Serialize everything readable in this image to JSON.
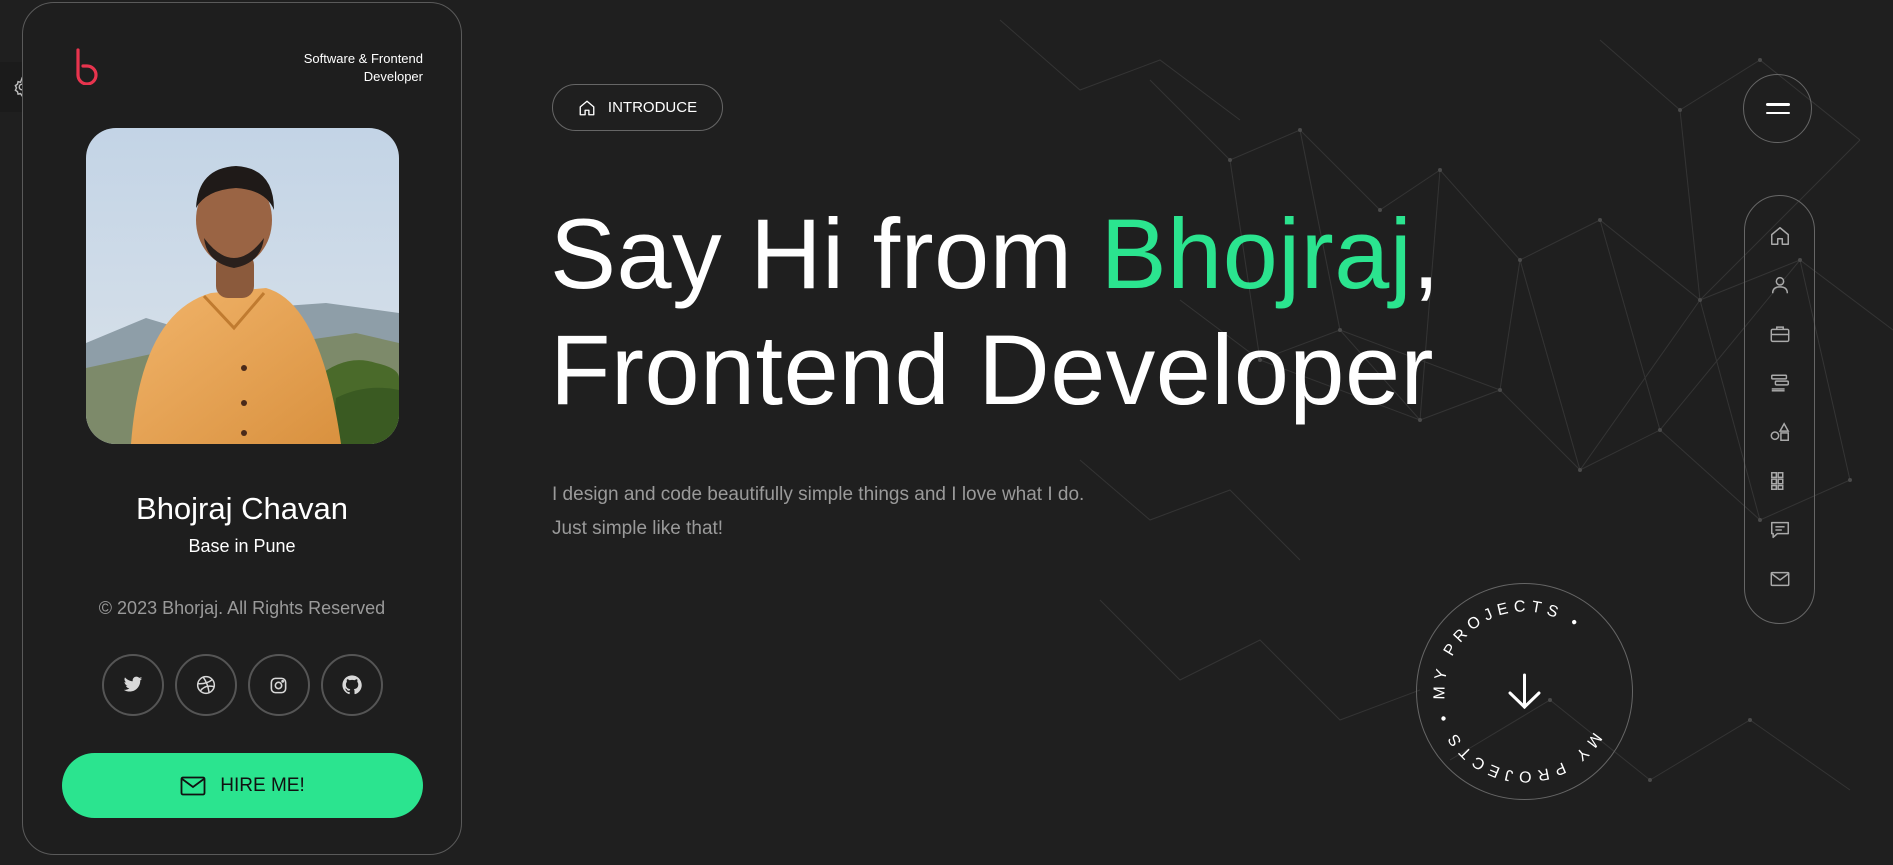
{
  "profile": {
    "role": "Software & Frontend Developer",
    "name": "Bhojraj Chavan",
    "base": "Base in Pune",
    "copyright": "© 2023 Bhorjaj. All Rights Reserved",
    "social_icons": [
      "twitter-icon",
      "dribbble-icon",
      "instagram-icon",
      "github-icon"
    ],
    "hire_label": "HIRE ME!"
  },
  "hero": {
    "badge_label": "INTRODUCE",
    "headline_prefix": "Say Hi from ",
    "headline_name": "Bhojraj",
    "headline_comma": ",",
    "headline_line2": "Frontend Developer",
    "sub_line1": "I design and code beautifully simple things and I love what I do.",
    "sub_line2": "Just simple like that!"
  },
  "projects_badge": {
    "ring_text": "MY PROJECTS • MY PROJECTS •"
  },
  "sidenav": {
    "items": [
      "home-icon",
      "user-icon",
      "briefcase-icon",
      "resume-icon",
      "shapes-icon",
      "grid-icon",
      "comment-icon",
      "mail-icon"
    ]
  },
  "colors": {
    "accent": "#2be48f",
    "logo": "#e8344e",
    "background": "#1f1f1f"
  }
}
